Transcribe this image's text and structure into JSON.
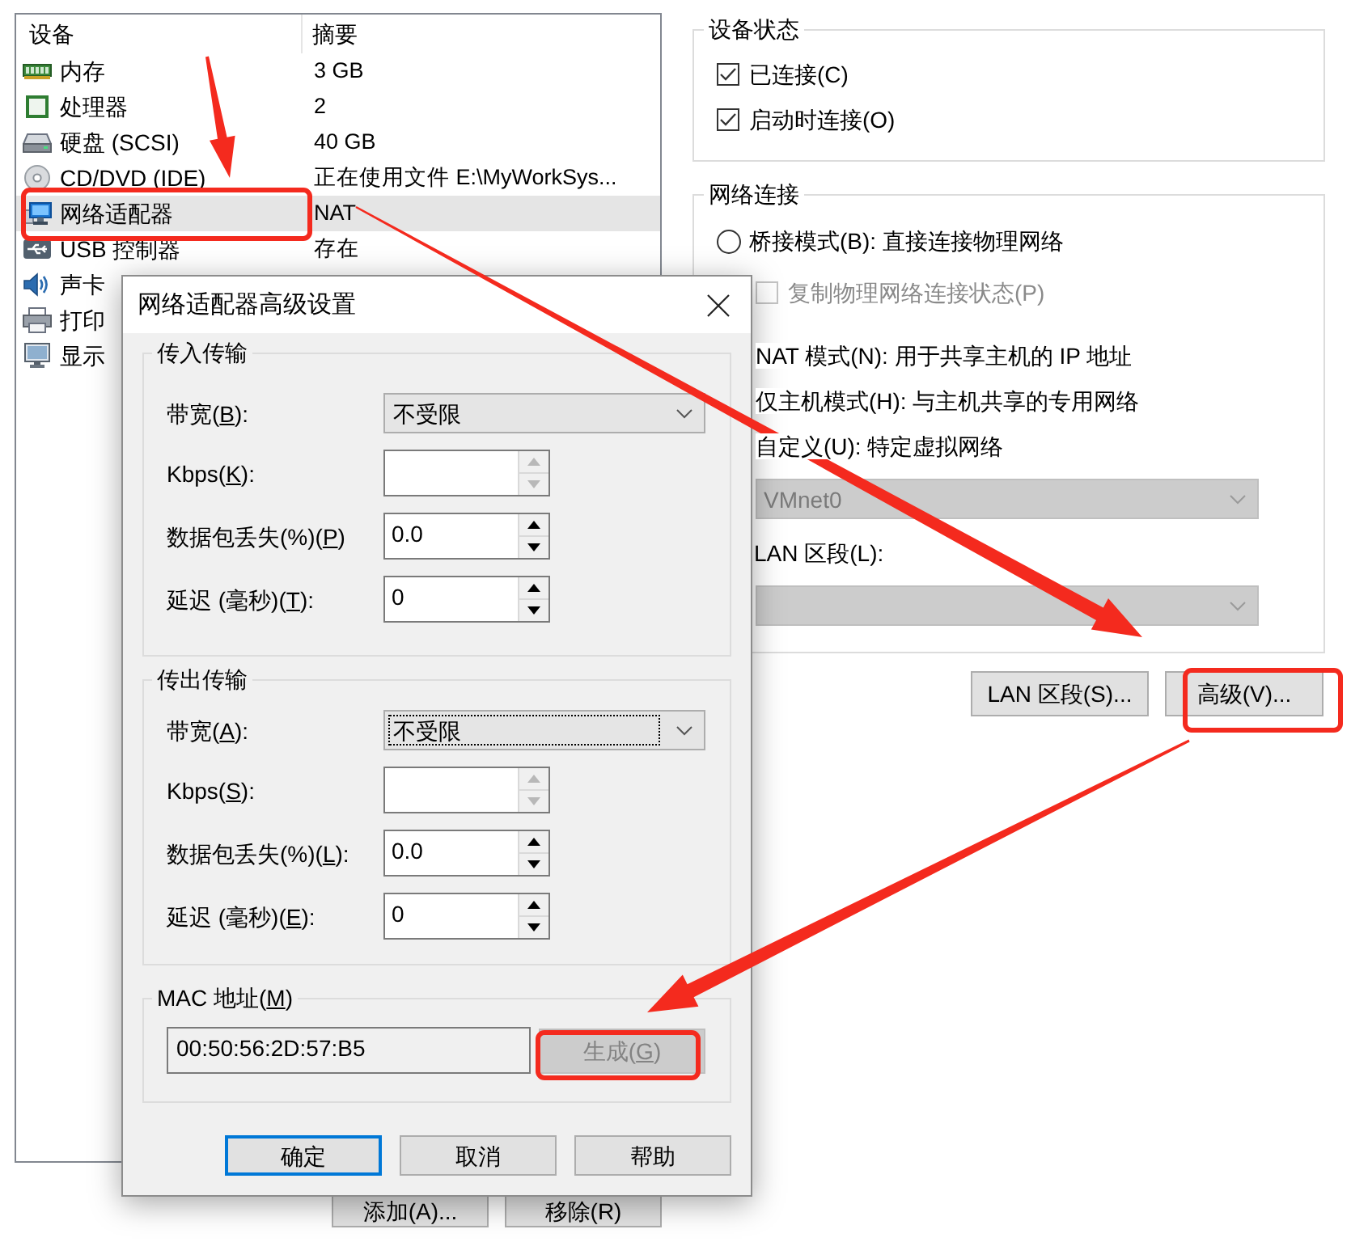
{
  "devices": {
    "columns": [
      "设备",
      "摘要"
    ],
    "rows": [
      {
        "kind": "memory",
        "name": "内存",
        "summary": "3 GB",
        "selected": false
      },
      {
        "kind": "cpu",
        "name": "处理器",
        "summary": "2",
        "selected": false
      },
      {
        "kind": "disk",
        "name": "硬盘 (SCSI)",
        "summary": "40 GB",
        "selected": false
      },
      {
        "kind": "cdrom",
        "name": "CD/DVD (IDE)",
        "summary": "正在使用文件 E:\\MyWorkSys...",
        "selected": false
      },
      {
        "kind": "network",
        "name": "网络适配器",
        "summary": "NAT",
        "selected": true
      },
      {
        "kind": "usb",
        "name": "USB 控制器",
        "summary": "存在",
        "selected": false
      },
      {
        "kind": "sound",
        "name": "声卡",
        "selected": false
      },
      {
        "kind": "printer",
        "name": "打印",
        "selected": false
      },
      {
        "kind": "display",
        "name": "显示",
        "selected": false
      }
    ]
  },
  "list_buttons": [
    "添加(A)...",
    "移除(R)"
  ],
  "device_status": {
    "title": "设备状态",
    "options": [
      {
        "label": "已连接(C)",
        "checked": true
      },
      {
        "label": "启动时连接(O)",
        "checked": true
      }
    ]
  },
  "network_connection": {
    "title": "网络连接",
    "bridged": {
      "label": "桥接模式(B): 直接连接物理网络",
      "selected": false
    },
    "replicate_state": {
      "label": "复制物理网络连接状态(P)",
      "checked": false,
      "disabled": true
    },
    "mode_labels": [
      "NAT 模式(N): 用于共享主机的 IP 地址",
      "仅主机模式(H): 与主机共享的专用网络",
      "自定义(U): 特定虚拟网络"
    ],
    "vmnet_dropdown": {
      "value": "VMnet0",
      "disabled": true
    },
    "lan_segment_label": "LAN 区段(L):",
    "lan_segment_dropdown": {
      "disabled": true
    }
  },
  "action_buttons": [
    "LAN 区段(S)...",
    "高级(V)..."
  ],
  "dialog": {
    "title": "网络适配器高级设置",
    "groups": [
      {
        "title": "传入传输",
        "rows": [
          {
            "kind": "dropdown",
            "label": {
              "text_before": "带宽(",
              "access_key": "B",
              "text_after": "):"
            },
            "value": "不受限",
            "focused": false
          },
          {
            "kind": "spin",
            "label": {
              "text_before": "Kbps(",
              "access_key": "K",
              "text_after": "):"
            },
            "disabled": true
          },
          {
            "kind": "spin",
            "label": {
              "text_before": "数据包丢失(%)(",
              "access_key": "P",
              "text_after": ")"
            },
            "value": "0.0",
            "disabled": false
          },
          {
            "kind": "spin",
            "label": {
              "text_before": "延迟 (毫秒)(",
              "access_key": "T",
              "text_after": "):"
            },
            "value": "0",
            "disabled": false
          }
        ]
      },
      {
        "title": "传出传输",
        "rows": [
          {
            "kind": "dropdown",
            "label": {
              "text_before": "带宽(",
              "access_key": "A",
              "text_after": "):"
            },
            "value": "不受限",
            "focused": true
          },
          {
            "kind": "spin",
            "label": {
              "text_before": "Kbps(",
              "access_key": "S",
              "text_after": "):"
            },
            "disabled": true
          },
          {
            "kind": "spin",
            "label": {
              "text_before": "数据包丢失(%)(",
              "access_key": "L",
              "text_after": "):"
            },
            "value": "0.0",
            "disabled": false
          },
          {
            "kind": "spin",
            "label": {
              "text_before": "延迟 (毫秒)(",
              "access_key": "E",
              "text_after": "):"
            },
            "value": "0",
            "disabled": false
          }
        ]
      }
    ],
    "mac": {
      "title": {
        "text_before": "MAC 地址(",
        "access_key": "M",
        "text_after": ")"
      },
      "value": "00:50:56:2D:57:B5",
      "generate_button": {
        "label": {
          "text_before": "生成(",
          "access_key": "G",
          "text_after": ")"
        },
        "disabled": true
      }
    },
    "buttons": [
      {
        "label": "确定",
        "default": true
      },
      {
        "label": "取消",
        "default": false
      },
      {
        "label": "帮助",
        "default": false
      }
    ]
  }
}
